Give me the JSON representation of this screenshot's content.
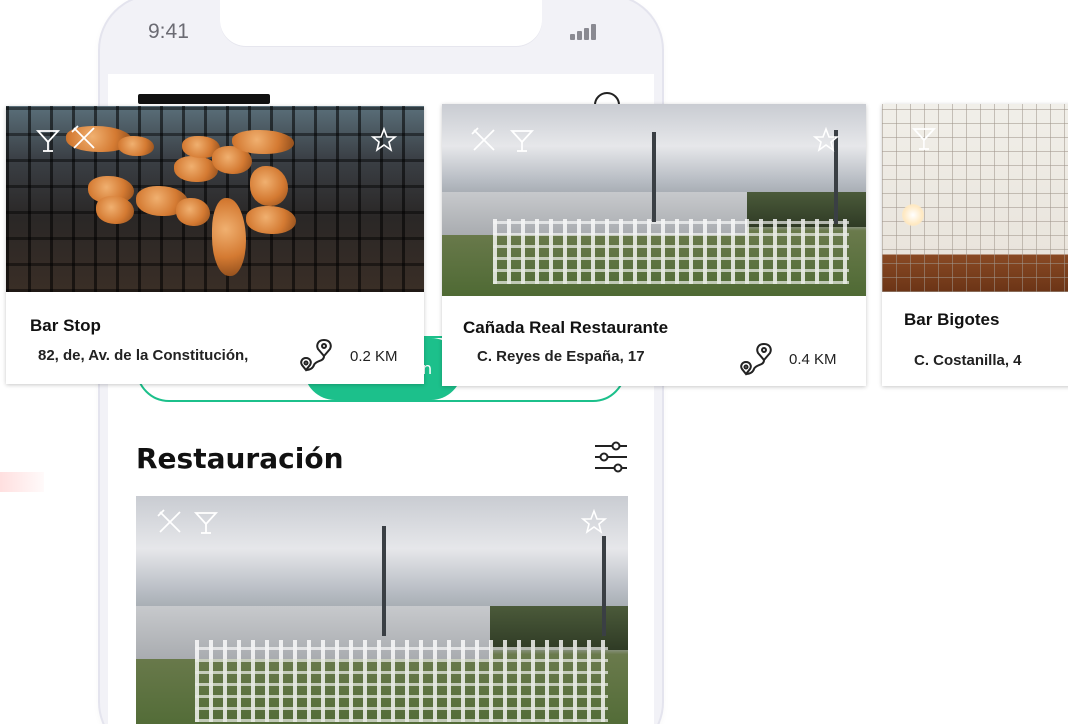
{
  "status_bar": {
    "time": "9:41"
  },
  "main": {
    "segment_active_label": "n",
    "section_title": "Restauración"
  },
  "cards": [
    {
      "name": "Bar Stop",
      "address": "82, de, Av. de la Constitución,",
      "distance": "0.2 KM",
      "icons": [
        "cocktail-icon",
        "cutlery-icon",
        "star-icon"
      ]
    },
    {
      "name": "Cañada Real Restaurante",
      "address": "C. Reyes de España, 17",
      "distance": "0.4 KM",
      "icons": [
        "cutlery-icon",
        "cocktail-icon",
        "star-icon"
      ]
    },
    {
      "name": "Bar Bigotes",
      "address": "C. Costanilla, 4",
      "icons": [
        "cocktail-icon"
      ]
    }
  ],
  "featured": {
    "icons": [
      "cutlery-icon",
      "cocktail-icon",
      "star-icon"
    ]
  },
  "colors": {
    "accent": "#1cc08b",
    "text": "#111111",
    "phone_bg": "#f2f2f7"
  }
}
